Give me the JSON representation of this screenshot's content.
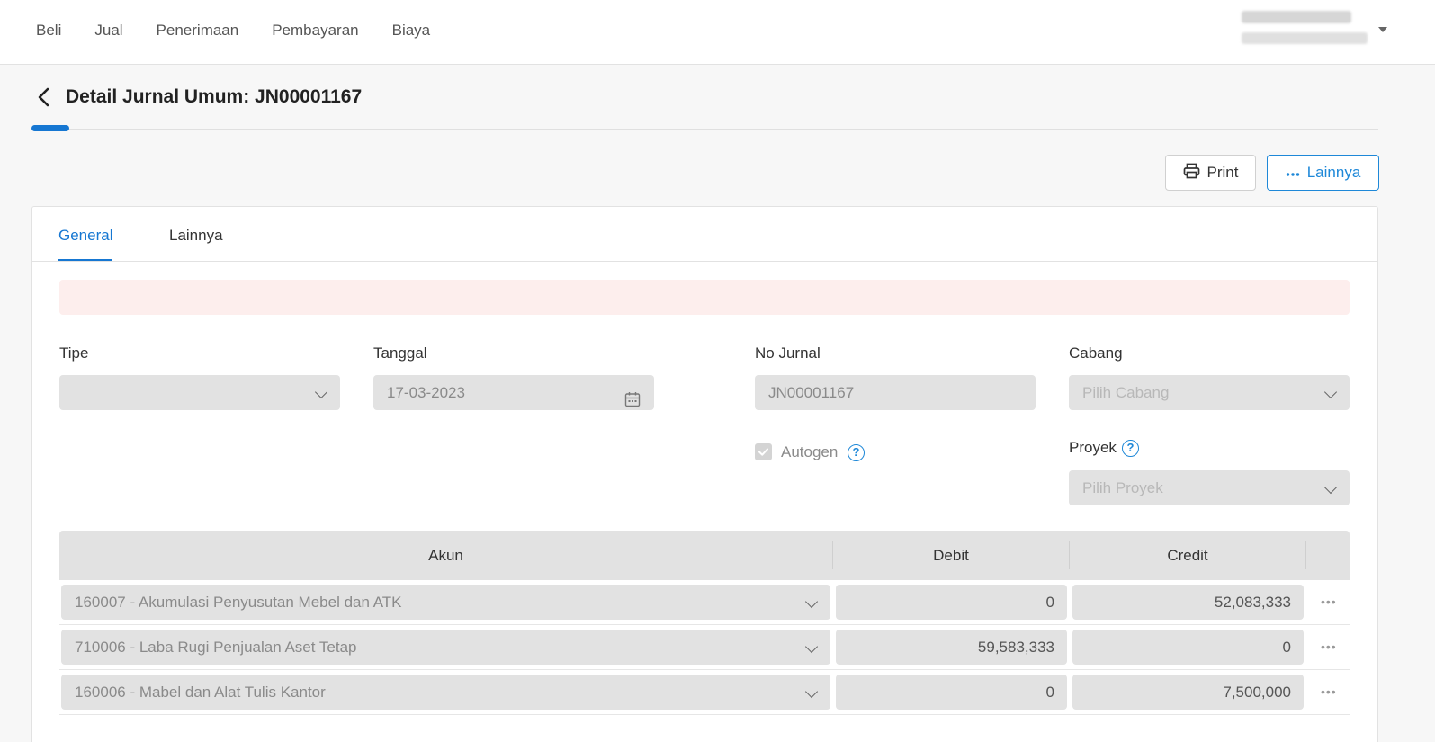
{
  "nav": {
    "items": [
      "Beli",
      "Jual",
      "Penerimaan",
      "Pembayaran",
      "Biaya"
    ]
  },
  "header": {
    "title": "Detail Jurnal Umum: JN00001167"
  },
  "actions": {
    "print": "Print",
    "more": "Lainnya"
  },
  "tabs": [
    "General",
    "Lainnya"
  ],
  "form": {
    "tipe_label": "Tipe",
    "tipe_value": "",
    "tanggal_label": "Tanggal",
    "tanggal_value": "17-03-2023",
    "no_jurnal_label": "No Jurnal",
    "no_jurnal_value": "JN00001167",
    "cabang_label": "Cabang",
    "cabang_placeholder": "Pilih Cabang",
    "autogen_label": "Autogen",
    "autogen_checked": true,
    "proyek_label": "Proyek",
    "proyek_placeholder": "Pilih Proyek"
  },
  "table": {
    "headers": [
      "Akun",
      "Debit",
      "Credit"
    ],
    "rows": [
      {
        "akun": "160007 - Akumulasi Penyusutan Mebel dan ATK",
        "debit": "0",
        "credit": "52,083,333"
      },
      {
        "akun": "710006 - Laba Rugi Penjualan Aset Tetap",
        "debit": "59,583,333",
        "credit": "0"
      },
      {
        "akun": "160006 - Mabel dan Alat Tulis Kantor",
        "debit": "0",
        "credit": "7,500,000"
      }
    ]
  },
  "icons": {
    "back": "chevron-left-icon",
    "print": "printer-icon",
    "more": "ellipsis-icon",
    "calendar": "calendar-icon",
    "help": "question-circle-icon",
    "dropdown": "chevron-down-icon"
  },
  "colors": {
    "accent": "#1677d2",
    "alert_bg": "#fdeeed",
    "field_bg": "#e2e2e2"
  }
}
